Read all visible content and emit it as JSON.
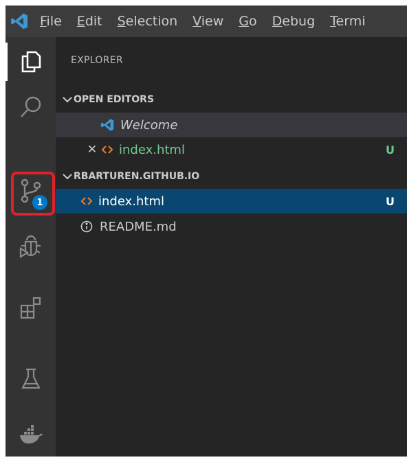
{
  "menubar": {
    "items": [
      {
        "mnemonic": "F",
        "rest": "ile"
      },
      {
        "mnemonic": "E",
        "rest": "dit"
      },
      {
        "mnemonic": "S",
        "rest": "election"
      },
      {
        "mnemonic": "V",
        "rest": "iew"
      },
      {
        "mnemonic": "G",
        "rest": "o"
      },
      {
        "mnemonic": "D",
        "rest": "ebug"
      },
      {
        "mnemonic": "T",
        "rest": "ermi"
      }
    ]
  },
  "activitybar": {
    "items": [
      "files-icon",
      "search-icon",
      "source-control-icon",
      "debug-icon",
      "extensions-icon",
      "testing-icon",
      "docker-icon"
    ],
    "source_control_badge": "1",
    "highlight_color": "#e0202a",
    "badge_color": "#007acc"
  },
  "explorer": {
    "title": "EXPLORER",
    "open_editors": {
      "header": "OPEN EDITORS",
      "items": [
        {
          "name": "Welcome",
          "icon": "vscode-logo-icon",
          "italic": true,
          "status": ""
        },
        {
          "name": "index.html",
          "icon": "html-file-icon",
          "status": "U",
          "status_color": "#73c991"
        }
      ]
    },
    "folder": {
      "header": "RBARTUREN.GITHUB.IO",
      "items": [
        {
          "name": "index.html",
          "icon": "html-file-icon",
          "status": "U",
          "selected": true
        },
        {
          "name": "README.md",
          "icon": "info-icon",
          "status": ""
        }
      ]
    }
  },
  "colors": {
    "menubar_bg": "#3c3c3c",
    "activitybar_bg": "#333333",
    "sidebar_bg": "#252526",
    "selection_bg": "#094771",
    "untracked_green": "#73c991",
    "html_icon_orange": "#e37933",
    "vscode_blue": "#3c99d4"
  }
}
